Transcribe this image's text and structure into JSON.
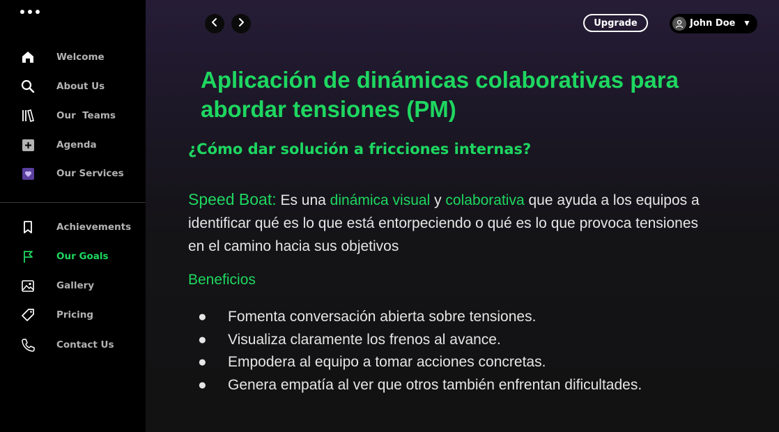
{
  "sidebar": {
    "items_top": [
      {
        "label": "Welcome",
        "icon": "home-icon"
      },
      {
        "label": "About Us",
        "icon": "search-icon"
      },
      {
        "label": "Our  Teams",
        "icon": "library-icon"
      },
      {
        "label": "Agenda",
        "icon": "plus-square-icon"
      },
      {
        "label": "Our Services",
        "icon": "heart-square-icon"
      }
    ],
    "items_bottom": [
      {
        "label": "Achievements",
        "icon": "bookmark-icon"
      },
      {
        "label": "Our Goals",
        "icon": "flag-icon",
        "active": true
      },
      {
        "label": "Gallery",
        "icon": "image-icon"
      },
      {
        "label": "Pricing",
        "icon": "tag-icon"
      },
      {
        "label": "Contact Us",
        "icon": "phone-icon"
      }
    ]
  },
  "header": {
    "back_icon": "chevron-left-icon",
    "forward_icon": "chevron-right-icon",
    "upgrade_label": "Upgrade",
    "user_name": "John Doe",
    "user_icon": "user-icon"
  },
  "content": {
    "title": "Aplicación de dinámicas colaborativas para abordar tensiones (PM)",
    "subtitle": "¿Cómo dar solución a fricciones internas?",
    "paragraph": {
      "term": "Speed Boat:",
      "p1": " Es una ",
      "hl1": "dinámica visual",
      "p2": " y ",
      "hl2": "colaborativa",
      "p3": " que ayuda a los equipos a identificar qué es lo que está entorpeciendo o qué es lo que provoca tensiones en el camino hacia sus objetivos"
    },
    "benefits_heading": "Beneficios",
    "benefits": [
      "Fomenta conversación abierta sobre tensiones.",
      "Visualiza claramente los frenos al avance.",
      "Empodera al equipo a tomar acciones concretas.",
      "Genera empatía al ver que otros también enfrentan dificultades."
    ],
    "bullet": "●"
  },
  "colors": {
    "accent": "#1ed760",
    "sidebar_bg": "#000000",
    "main_bg": "#121212",
    "inactive_text": "#b3b3b3"
  }
}
